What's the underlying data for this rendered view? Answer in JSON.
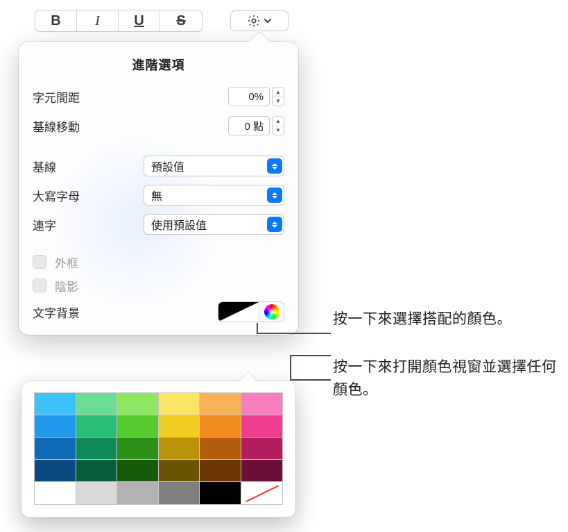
{
  "toolbar": {
    "bold": "B",
    "italic": "I",
    "underline": "U",
    "strike": "S"
  },
  "popover": {
    "title": "進階選項",
    "char_spacing_label": "字元間距",
    "char_spacing_value": "0%",
    "baseline_shift_label": "基線移動",
    "baseline_shift_value": "0 點",
    "baseline_label": "基線",
    "baseline_value": "預設值",
    "caps_label": "大寫字母",
    "caps_value": "無",
    "ligature_label": "連字",
    "ligature_value": "使用預設值",
    "outline_label": "外框",
    "shadow_label": "陰影",
    "text_bg_label": "文字背景"
  },
  "swatches": {
    "row1": [
      "#3EC0F9",
      "#6CDC94",
      "#8DE763",
      "#FBE567",
      "#F9B25B",
      "#F77FBE"
    ],
    "row2": [
      "#1F97EA",
      "#29BC74",
      "#56CB2F",
      "#F0CD22",
      "#F08B1E",
      "#EE3D8F"
    ],
    "row3": [
      "#0D6AB7",
      "#0E8B58",
      "#2C8F16",
      "#B99208",
      "#B35C0B",
      "#B31C5F"
    ],
    "row4": [
      "#094A82",
      "#065E3C",
      "#175A0B",
      "#6B5504",
      "#6E3606",
      "#6C1039"
    ],
    "gray": [
      "#FFFFFF",
      "#D9D9D9",
      "#B2B2B2",
      "#808080",
      "#000000"
    ]
  },
  "callouts": {
    "c1": "按一下來選擇搭配的顏色。",
    "c2": "按一下來打開顏色視窗並選擇任何顏色。"
  }
}
